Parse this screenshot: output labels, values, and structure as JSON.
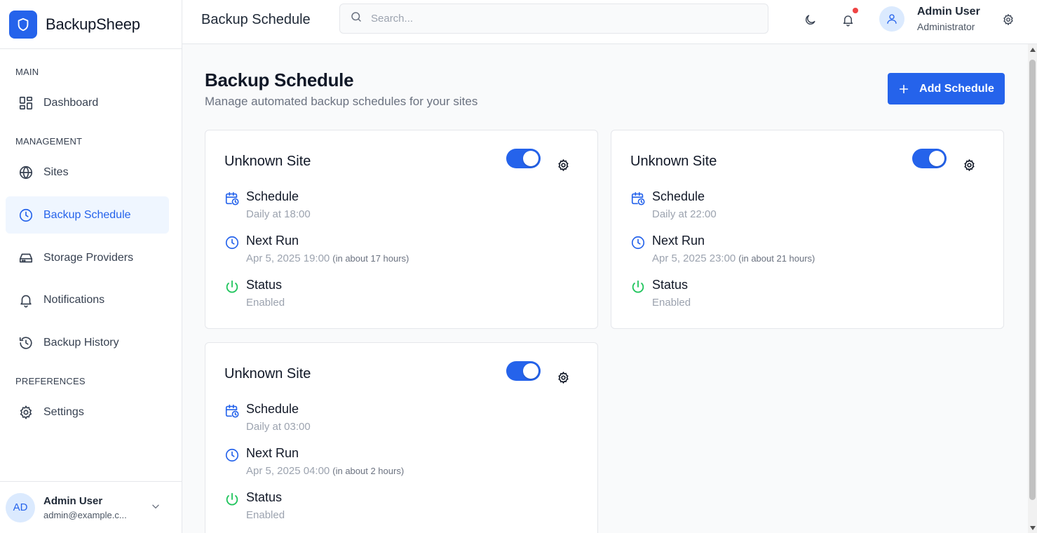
{
  "brand": {
    "name": "BackupSheep",
    "logo_icon": "shield-icon"
  },
  "sidebar": {
    "sections": [
      {
        "label": "MAIN"
      },
      {
        "label": "MANAGEMENT"
      },
      {
        "label": "PREFERENCES"
      }
    ],
    "items": [
      {
        "label": "Dashboard",
        "icon": "dashboard-icon"
      },
      {
        "label": "Sites",
        "icon": "globe-icon"
      },
      {
        "label": "Backup Schedule",
        "icon": "clock-icon",
        "active": true
      },
      {
        "label": "Storage Providers",
        "icon": "hard-drive-icon"
      },
      {
        "label": "Notifications",
        "icon": "bell-icon"
      },
      {
        "label": "Backup History",
        "icon": "history-icon"
      },
      {
        "label": "Settings",
        "icon": "gear-icon"
      }
    ],
    "footer": {
      "initials": "AD",
      "name": "Admin User",
      "email": "admin@example.c..."
    }
  },
  "topbar": {
    "title": "Backup Schedule",
    "search_placeholder": "Search...",
    "user_name": "Admin User",
    "user_role": "Administrator"
  },
  "page": {
    "title": "Backup Schedule",
    "subtitle": "Manage automated backup schedules for your sites",
    "add_button": "Add Schedule"
  },
  "schedules": [
    {
      "site": "Unknown Site",
      "enabled": true,
      "schedule_label": "Schedule",
      "schedule_value": "Daily at 18:00",
      "next_run_label": "Next Run",
      "next_run_value": "Apr 5, 2025 19:00",
      "next_run_relative": "(in about 17 hours)",
      "status_label": "Status",
      "status_value": "Enabled"
    },
    {
      "site": "Unknown Site",
      "enabled": true,
      "schedule_label": "Schedule",
      "schedule_value": "Daily at 22:00",
      "next_run_label": "Next Run",
      "next_run_value": "Apr 5, 2025 23:00",
      "next_run_relative": "(in about 21 hours)",
      "status_label": "Status",
      "status_value": "Enabled"
    },
    {
      "site": "Unknown Site",
      "enabled": true,
      "schedule_label": "Schedule",
      "schedule_value": "Daily at 03:00",
      "next_run_label": "Next Run",
      "next_run_value": "Apr 5, 2025 04:00",
      "next_run_relative": "(in about 2 hours)",
      "status_label": "Status",
      "status_value": "Enabled"
    }
  ],
  "colors": {
    "accent": "#2563eb",
    "status_enabled": "#22c55e",
    "notification_dot": "#ef4444"
  }
}
